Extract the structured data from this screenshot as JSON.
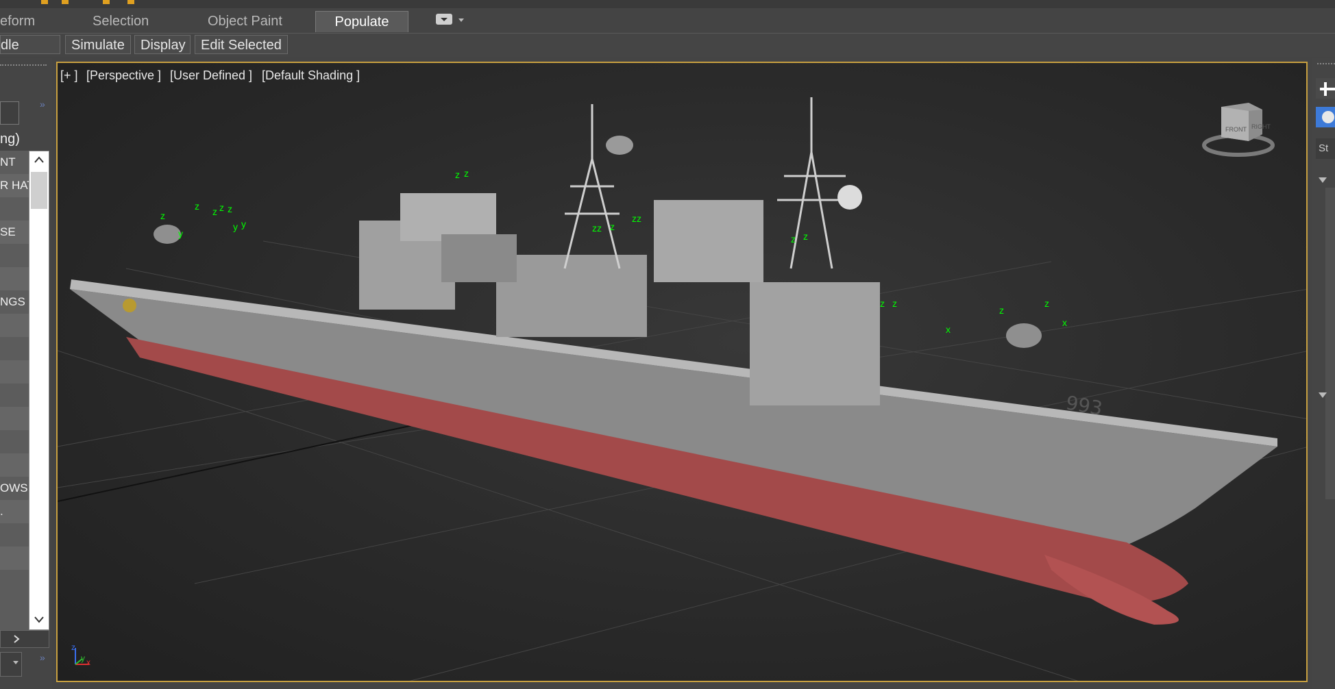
{
  "ribbon": {
    "tabs": [
      {
        "label": "eform"
      },
      {
        "label": "Selection"
      },
      {
        "label": "Object Paint"
      },
      {
        "label": "Populate",
        "active": true
      }
    ],
    "sub_buttons": [
      {
        "label": "dle Areas"
      },
      {
        "label": "Simulate"
      },
      {
        "label": "Display"
      },
      {
        "label": "Edit Selected"
      }
    ]
  },
  "left_panel": {
    "header_text": "ng)",
    "list_items": [
      "NT",
      "R HAT",
      "",
      "SE",
      "",
      "",
      "NGS",
      "",
      "",
      "",
      "",
      "",
      "",
      "",
      "OWS",
      ".",
      "",
      ""
    ]
  },
  "viewport": {
    "labels": [
      "[+ ]",
      "[Perspective ]",
      "[User Defined ]",
      "[Default Shading ]"
    ],
    "viewcube": {
      "front": "FRONT",
      "right": "RIGHT"
    },
    "hull_number": "993",
    "axis_gizmo": {
      "x": "x",
      "y": "y",
      "z": "z"
    }
  },
  "right_panel": {
    "partial_text": "St"
  },
  "icons": [
    "plus-icon",
    "sphere-icon",
    "dropdown-icon",
    "chevron-up-icon",
    "chevron-down-icon",
    "chevron-right-icon",
    "double-chevron-icon"
  ],
  "colors": {
    "viewport_border": "#c8a040",
    "hull_red": "#a84848",
    "gizmo_green": "#00ff00"
  }
}
